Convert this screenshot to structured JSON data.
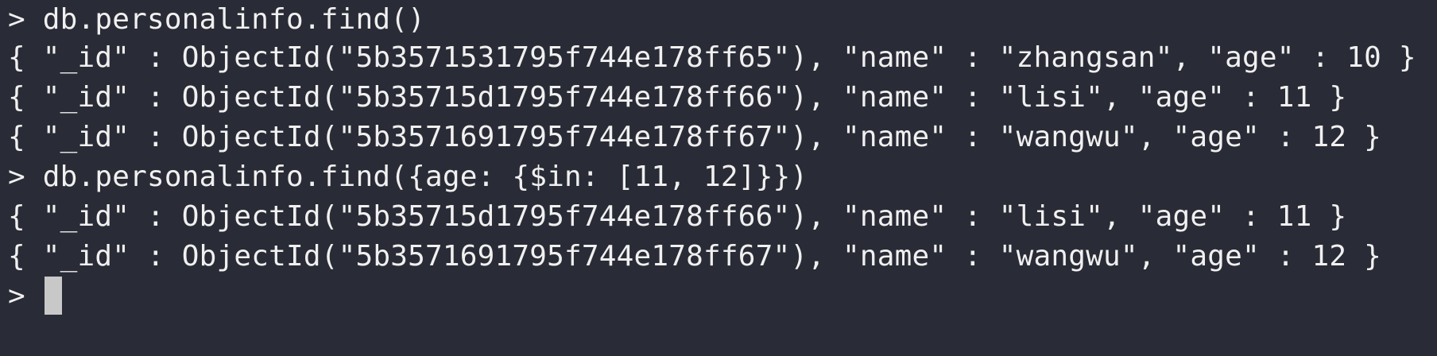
{
  "terminal": {
    "lines": [
      "> db.personalinfo.find()",
      "{ \"_id\" : ObjectId(\"5b3571531795f744e178ff65\"), \"name\" : \"zhangsan\", \"age\" : 10 }",
      "{ \"_id\" : ObjectId(\"5b35715d1795f744e178ff66\"), \"name\" : \"lisi\", \"age\" : 11 }",
      "{ \"_id\" : ObjectId(\"5b3571691795f744e178ff67\"), \"name\" : \"wangwu\", \"age\" : 12 }",
      "> db.personalinfo.find({age: {$in: [11, 12]}})",
      "{ \"_id\" : ObjectId(\"5b35715d1795f744e178ff66\"), \"name\" : \"lisi\", \"age\" : 11 }",
      "{ \"_id\" : ObjectId(\"5b3571691795f744e178ff67\"), \"name\" : \"wangwu\", \"age\" : 12 }"
    ],
    "prompt": "> "
  },
  "colors": {
    "background": "#292b36",
    "text": "#f0f0f0",
    "cursor": "#c8c8c8"
  }
}
